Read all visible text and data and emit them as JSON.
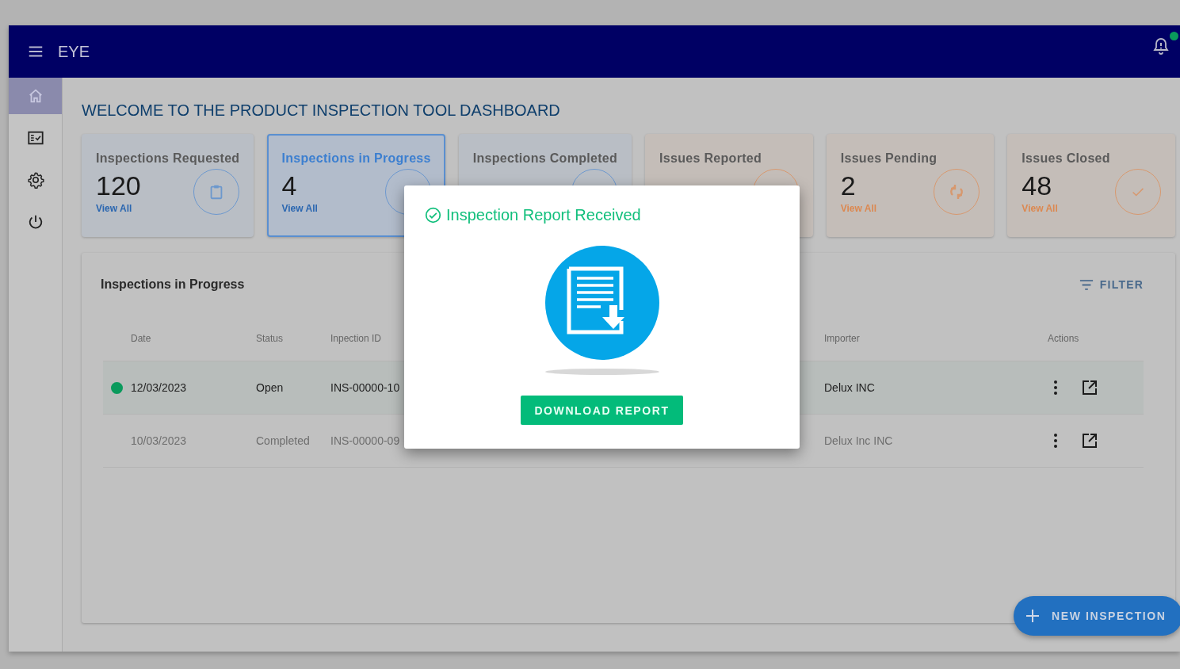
{
  "app_bar": {
    "title": "EYE",
    "notification_dot": true
  },
  "sidebar": {
    "items": [
      {
        "selected": true
      },
      {
        "selected": false
      },
      {
        "selected": false
      },
      {
        "selected": false
      }
    ]
  },
  "heading": "WELCOME TO THE PRODUCT INSPECTION TOOL DASHBOARD",
  "cards": [
    {
      "title": "Inspections Requested",
      "value": "120",
      "link": "View All",
      "kind": "inspection",
      "selected": false
    },
    {
      "title": "Inspections in Progress",
      "value": "4",
      "link": "View All",
      "kind": "inspection",
      "selected": true
    },
    {
      "title": "Inspections Completed",
      "kind": "inspection",
      "selected": false
    },
    {
      "title": "Issues Reported",
      "kind": "issue",
      "selected": false
    },
    {
      "title": "Issues Pending",
      "value": "2",
      "link": "View All",
      "kind": "issue",
      "selected": false
    },
    {
      "title": "Issues Closed",
      "value": "48",
      "link": "View All",
      "kind": "issue",
      "selected": false
    }
  ],
  "table": {
    "title": "Inspections in Progress",
    "filter_label": "FILTER",
    "columns": [
      "Date",
      "Status",
      "Inpection ID",
      "Importer",
      "Actions"
    ],
    "rows": [
      {
        "date": "12/03/2023",
        "status": "Open",
        "inspection_id": "INS-00000-10",
        "importer": "Delux INC",
        "selected": true,
        "color": "#0a9a5c"
      },
      {
        "date": "10/03/2023",
        "status": "Completed",
        "inspection_id": "INS-00000-09",
        "importer": "Delux Inc INC",
        "selected": false
      }
    ]
  },
  "fab": {
    "label": "NEW INSPECTION"
  },
  "dialog": {
    "title": "Inspection Report Received",
    "button": "DOWNLOAD REPORT"
  }
}
